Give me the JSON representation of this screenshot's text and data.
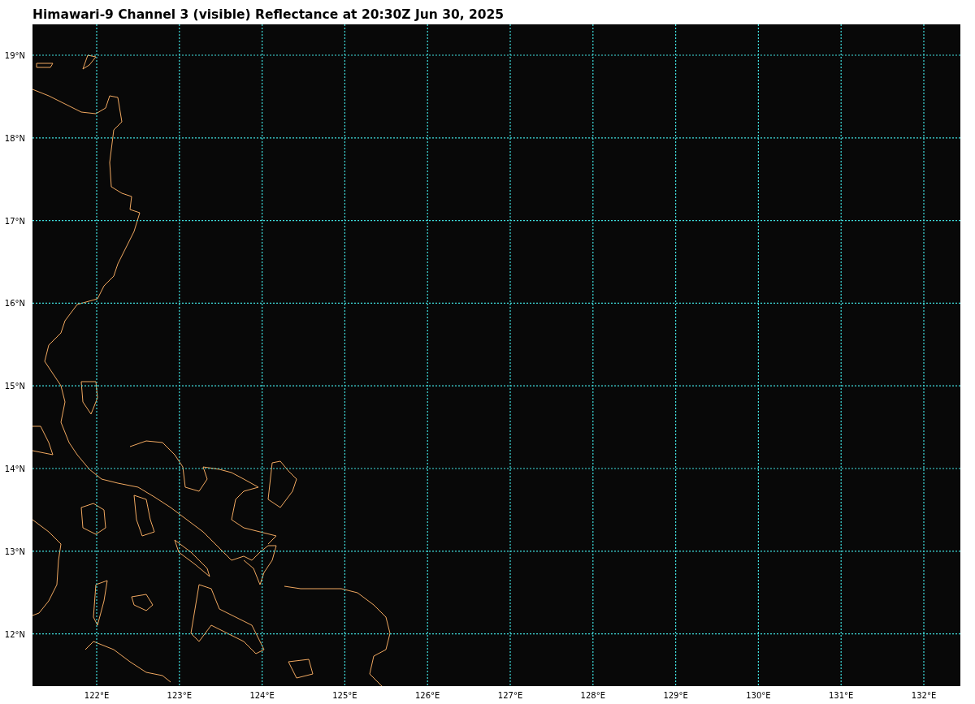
{
  "title": "Himawari-9 Channel 3 (visible) Reflectance at 20:30Z Jun 30, 2025",
  "map": {
    "lat_labels": [
      "19°N",
      "18°N",
      "17°N",
      "16°N",
      "15°N",
      "14°N",
      "13°N",
      "12°N"
    ],
    "lon_labels": [
      "122°E",
      "123°E",
      "124°E",
      "125°E",
      "126°E",
      "127°E",
      "128°E",
      "129°E",
      "130°E",
      "131°E",
      "132°E"
    ]
  }
}
